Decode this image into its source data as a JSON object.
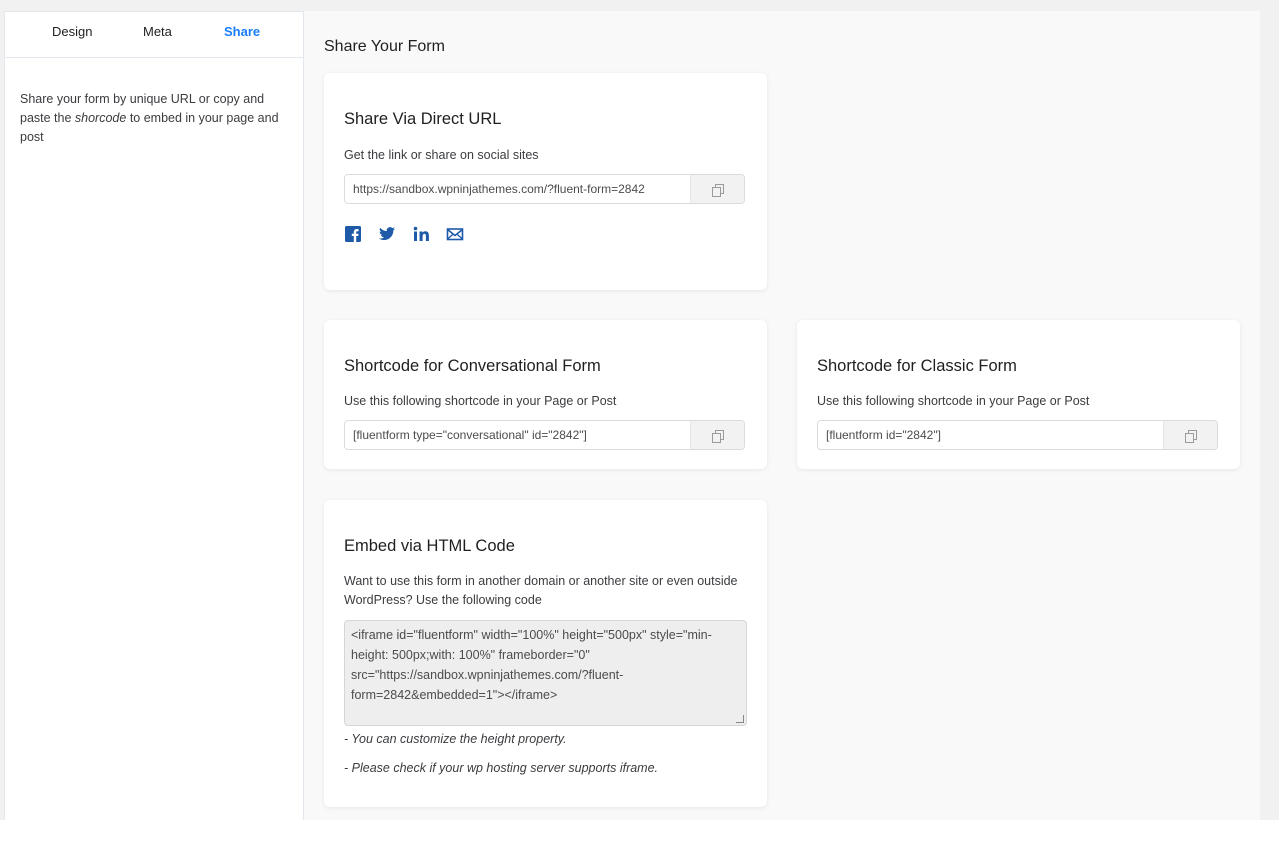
{
  "sidebar": {
    "tabs": [
      {
        "label": "Design"
      },
      {
        "label": "Meta"
      },
      {
        "label": "Share"
      }
    ],
    "description_pre": "Share your form by unique URL or copy and paste the ",
    "description_em": "shorcode",
    "description_post": " to embed in your page and post"
  },
  "main": {
    "title": "Share Your Form",
    "direct_url": {
      "heading": "Share Via Direct URL",
      "desc": "Get the link or share on social sites",
      "url": "https://sandbox.wpninjathemes.com/?fluent-form=2842",
      "socials": [
        "facebook-icon",
        "twitter-icon",
        "linkedin-icon",
        "email-icon"
      ]
    },
    "conversational": {
      "heading": "Shortcode for Conversational Form",
      "desc": "Use this following shortcode in your Page or Post",
      "code": "[fluentform type=\"conversational\" id=\"2842\"]"
    },
    "classic": {
      "heading": "Shortcode for Classic Form",
      "desc": "Use this following shortcode in your Page or Post",
      "code": "[fluentform id=\"2842\"]"
    },
    "embed": {
      "heading": "Embed via HTML Code",
      "desc": "Want to use this form in another domain or another site or even outside WordPress? Use the following code",
      "code": "<iframe id=\"fluentform\" width=\"100%\" height=\"500px\" style=\"min-height: 500px;with: 100%\" frameborder=\"0\" src=\"https://sandbox.wpninjathemes.com/?fluent-form=2842&embedded=1\"></iframe>",
      "note1": "- You can customize the height property.",
      "note2": "- Please check if your wp hosting server supports iframe."
    }
  },
  "colors": {
    "accent": "#1a7efb",
    "social_blue": "#1e5aa8"
  }
}
